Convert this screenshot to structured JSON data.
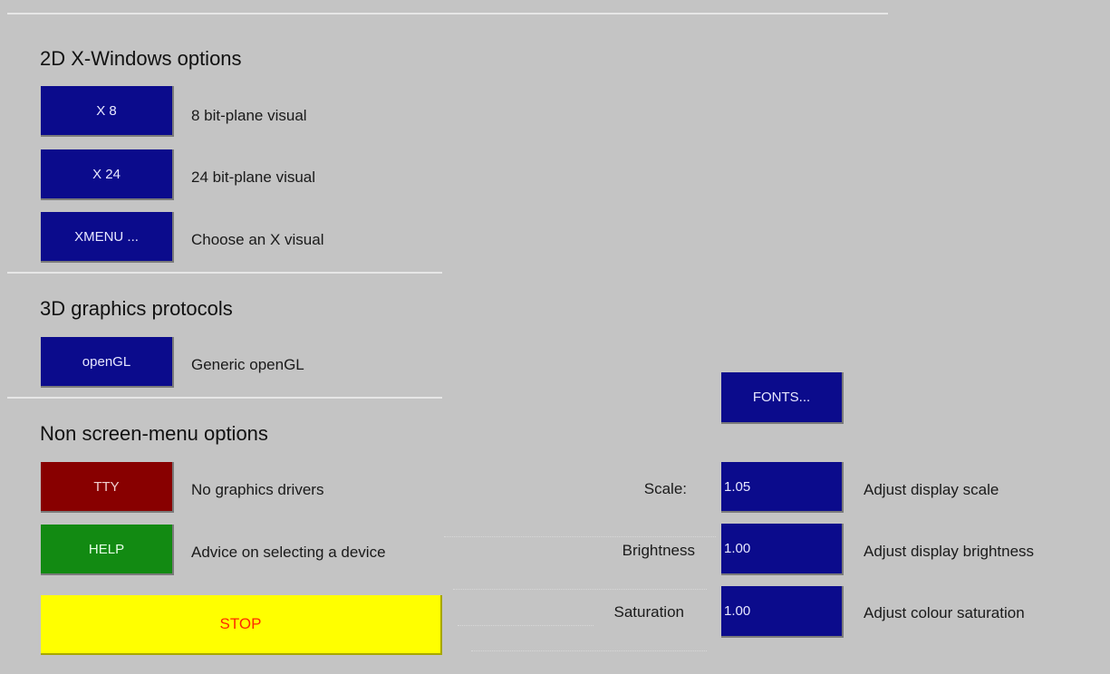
{
  "sections": {
    "xwindows": {
      "title": "2D X-Windows options",
      "buttons": [
        {
          "label": "X 8",
          "desc": "8 bit-plane visual"
        },
        {
          "label": "X 24",
          "desc": "24 bit-plane visual"
        },
        {
          "label": "XMENU ...",
          "desc": "Choose an X visual"
        }
      ]
    },
    "graphics3d": {
      "title": "3D graphics protocols",
      "buttons": [
        {
          "label": "openGL",
          "desc": "Generic openGL"
        }
      ]
    },
    "nonscreen": {
      "title": "Non screen-menu options",
      "buttons": [
        {
          "label": "TTY",
          "desc": "No graphics drivers"
        },
        {
          "label": "HELP",
          "desc": "Advice on selecting a device"
        }
      ],
      "stop_label": "STOP"
    }
  },
  "fonts_button": "FONTS...",
  "params": [
    {
      "label": "Scale:",
      "value": "1.05",
      "desc": "Adjust display scale"
    },
    {
      "label": "Brightness",
      "value": "1.00",
      "desc": "Adjust display brightness"
    },
    {
      "label": "Saturation",
      "value": "1.00",
      "desc": "Adjust colour saturation"
    }
  ],
  "colors": {
    "background": "#c4c4c4",
    "button_blue": "#0b0b8c",
    "button_red": "#880000",
    "button_green": "#128a12",
    "button_yellow": "#ffff00",
    "stop_text": "#ff2a00"
  }
}
